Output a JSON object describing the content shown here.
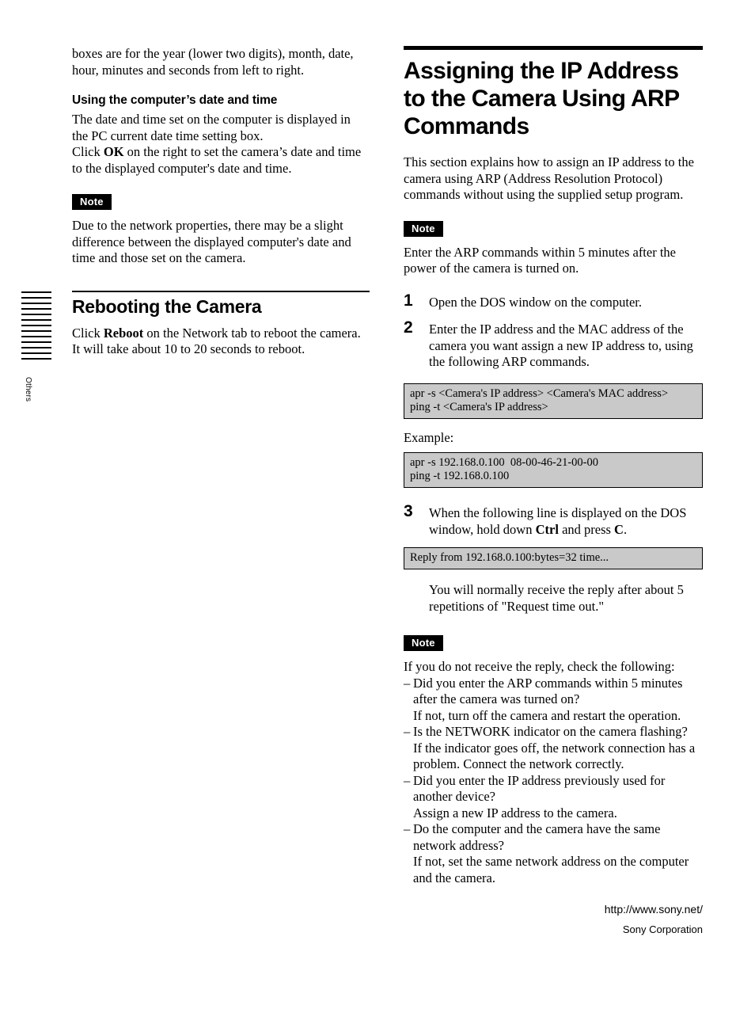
{
  "side_tab": {
    "label": "Others",
    "bar_count": 13
  },
  "left_column": {
    "intro_paragraph": "boxes are for the year (lower two digits), month, date, hour, minutes and seconds from left to right.",
    "subhead": "Using the computer’s date and time",
    "para_1": "The date and time set on the computer is displayed in the PC current date time setting box.",
    "para_2_prefix": "Click ",
    "para_2_bold": "OK",
    "para_2_suffix": " on the right to set the camera’s date and time to the displayed computer's date and time.",
    "note_label": "Note",
    "note_text": "Due to the network properties, there may be a slight difference between the displayed computer's date and time and those set on the camera.",
    "section_heading": "Rebooting the Camera",
    "reboot_prefix": "Click ",
    "reboot_bold": "Reboot",
    "reboot_suffix": " on the Network tab to reboot the camera. It will take about 10 to 20 seconds to reboot."
  },
  "right_column": {
    "chapter_title": "Assigning the IP Address to the Camera Using ARP Commands",
    "intro": "This section explains how to assign an IP address to the camera using ARP (Address Resolution Protocol) commands without using the supplied setup program.",
    "note_label": "Note",
    "note_text": "Enter the ARP commands within 5 minutes after the power of the camera is turned on.",
    "steps": [
      {
        "number": "1",
        "text": "Open the DOS window on the computer."
      },
      {
        "number": "2",
        "text": "Enter the IP address and the MAC address of the camera you want assign a new IP address to, using the following ARP commands."
      },
      {
        "number": "3",
        "text_prefix": "When the following line is displayed on the DOS window, hold down ",
        "text_bold_1": "Ctrl",
        "text_middle": " and press ",
        "text_bold_2": "C",
        "text_suffix": "."
      }
    ],
    "code_syntax": "apr -s <Camera's IP address> <Camera's MAC address>\nping -t <Camera's IP address>",
    "example_label": "Example:",
    "code_example": "apr -s 192.168.0.100  08-00-46-21-00-00\nping -t 192.168.0.100",
    "code_reply": "Reply from 192.168.0.100:bytes=32 time...",
    "after_reply_text": "You will normally receive the reply after about 5 repetitions of \"Request time out.\"",
    "note2_label": "Note",
    "note2_intro": "If you do not receive the reply, check the following:",
    "checks": [
      {
        "dash": "–",
        "question": "Did you enter the ARP commands within 5 minutes after the camera was turned on?",
        "answer": "If not, turn off the camera and restart the operation."
      },
      {
        "dash": "–",
        "question": "Is the NETWORK indicator on the camera flashing?",
        "answer": "If the indicator goes off, the network connection has a problem.  Connect the network correctly."
      },
      {
        "dash": "–",
        "question": "Did you enter the IP address previously used for another device?",
        "answer": "Assign a new IP address to the camera."
      },
      {
        "dash": "–",
        "question": "Do the computer and the camera have the same network address?",
        "answer": "If not, set the same network address on the computer and the camera."
      }
    ]
  },
  "footer": {
    "url": "http://www.sony.net/",
    "corporation": "Sony Corporation"
  },
  "colors": {
    "code_background": "#c9c9c9",
    "note_badge_background": "#000000",
    "text": "#000000"
  }
}
